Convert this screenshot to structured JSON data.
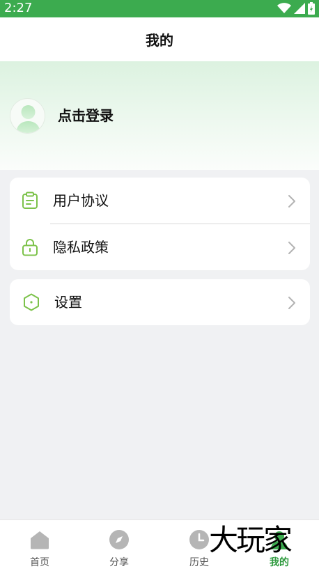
{
  "status_bar": {
    "time": "2:27"
  },
  "header": {
    "title": "我的"
  },
  "profile": {
    "login_label": "点击登录"
  },
  "menu": {
    "items": [
      {
        "label": "用户协议",
        "icon": "document-icon"
      },
      {
        "label": "隐私政策",
        "icon": "lock-icon"
      },
      {
        "label": "设置",
        "icon": "hexagon-settings-icon"
      }
    ]
  },
  "tab_bar": {
    "tabs": [
      {
        "label": "首页",
        "icon": "home-icon"
      },
      {
        "label": "分享",
        "icon": "compass-icon"
      },
      {
        "label": "历史",
        "icon": "clock-icon"
      },
      {
        "label": "我的",
        "icon": "profile-icon",
        "active": true
      }
    ]
  },
  "watermark": {
    "text": "大玩家"
  },
  "colors": {
    "accent": "#3cab4f",
    "active_tab": "#2e9a3e",
    "icon_green": "#7cc24a"
  }
}
